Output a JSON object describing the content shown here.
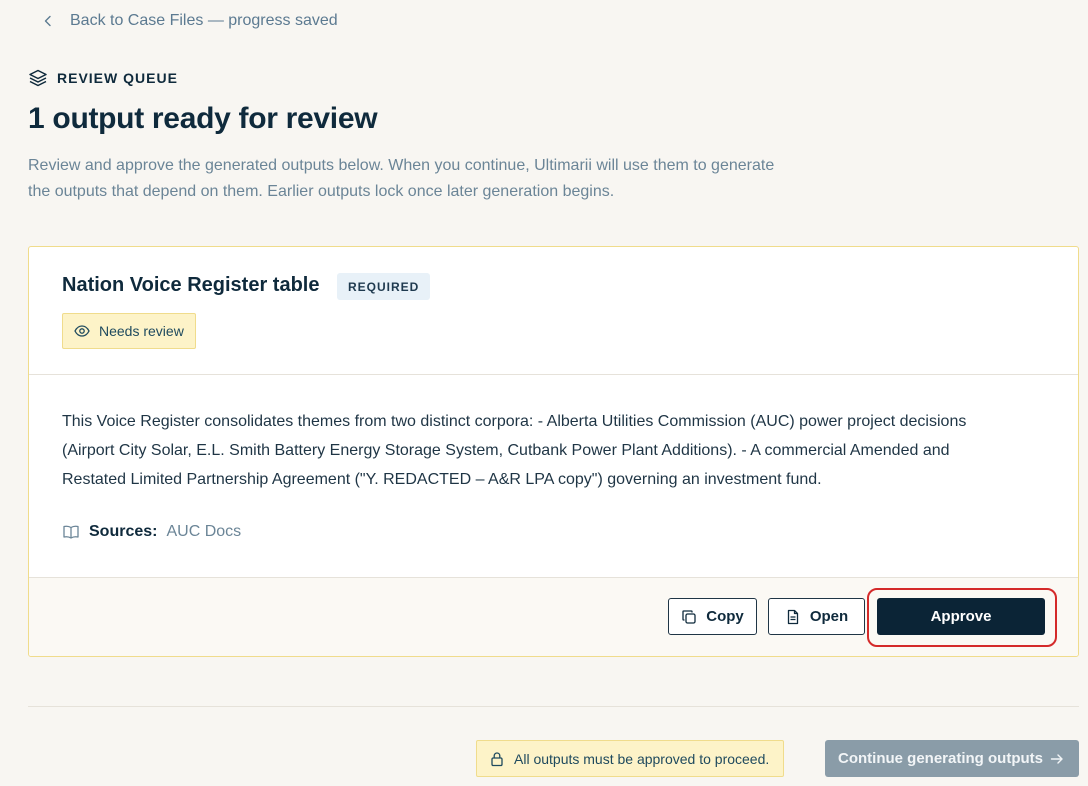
{
  "nav": {
    "back_label": "Back to Case Files — progress saved",
    "back_icon": "chevron-left-icon"
  },
  "header": {
    "eyebrow": "REVIEW QUEUE",
    "eyebrow_icon": "layers-icon",
    "title": "1 output ready for review",
    "intro": "Review and approve the generated outputs below. When you continue, Ultimarii will use them to generate the outputs that depend on them. Earlier outputs lock once later generation begins."
  },
  "card": {
    "title": "Nation Voice Register table",
    "required_badge": "REQUIRED",
    "status": {
      "label": "Needs review",
      "icon": "eye-icon"
    },
    "summary": "This Voice Register consolidates themes from two distinct corpora: - Alberta Utilities Commission (AUC) power project decisions (Airport City Solar, E.L. Smith Battery Energy Storage System, Cutbank Power Plant Additions). - A commercial Amended and Restated Limited Partnership Agreement (\"Y. REDACTED – A&R LPA copy\") governing an investment fund.",
    "sources": {
      "label": "Sources:",
      "value": "AUC Docs",
      "icon": "book-icon"
    },
    "actions": {
      "copy_label": "Copy",
      "open_label": "Open",
      "approve_label": "Approve"
    }
  },
  "footer": {
    "notice": "All outputs must be approved to proceed.",
    "notice_icon": "lock-icon",
    "continue_label": "Continue generating outputs",
    "continue_icon": "arrow-right-icon"
  },
  "colors": {
    "background": "#f8f6f2",
    "primary": "#0b2436",
    "warning_bg": "#fdf3c8",
    "warning_border": "#f0dc8c",
    "highlight": "#d42a2a",
    "disabled": "#8a9ca8"
  }
}
